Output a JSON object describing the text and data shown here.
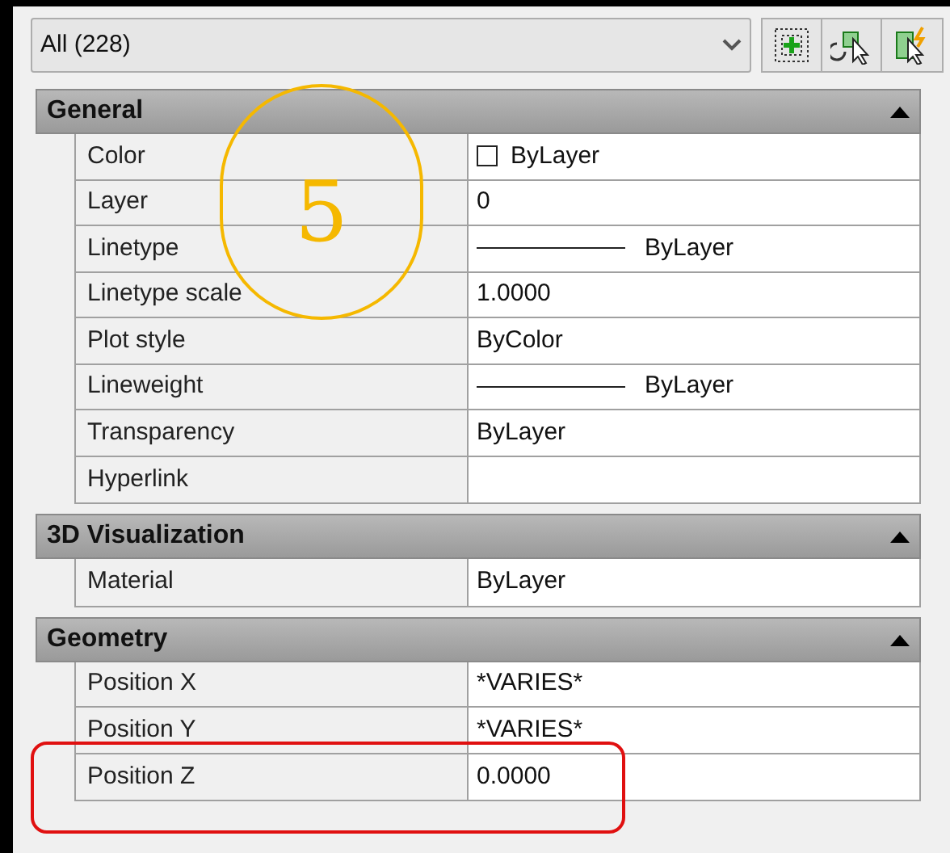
{
  "selector": {
    "value": "All (228)"
  },
  "sections": [
    {
      "title": "General",
      "expanded": true,
      "rows": [
        {
          "label": "Color",
          "value": "ByLayer",
          "kind": "swatch"
        },
        {
          "label": "Layer",
          "value": "0",
          "kind": "text"
        },
        {
          "label": "Linetype",
          "value": "ByLayer",
          "kind": "line"
        },
        {
          "label": "Linetype scale",
          "value": "1.0000",
          "kind": "text"
        },
        {
          "label": "Plot style",
          "value": "ByColor",
          "kind": "text"
        },
        {
          "label": "Lineweight",
          "value": "ByLayer",
          "kind": "line"
        },
        {
          "label": "Transparency",
          "value": "ByLayer",
          "kind": "text"
        },
        {
          "label": "Hyperlink",
          "kind": "text"
        }
      ]
    },
    {
      "title": "3D Visualization",
      "expanded": true,
      "rows": [
        {
          "label": "Material",
          "value": "ByLayer",
          "kind": "text"
        }
      ]
    },
    {
      "title": "Geometry",
      "expanded": true,
      "rows": [
        {
          "label": "Position X",
          "value": "*VARIES*",
          "kind": "text"
        },
        {
          "label": "Position Y",
          "value": "*VARIES*",
          "kind": "text"
        },
        {
          "label": "Position Z",
          "value": "0.0000",
          "kind": "text"
        }
      ]
    }
  ],
  "annotation": {
    "number": "5"
  }
}
